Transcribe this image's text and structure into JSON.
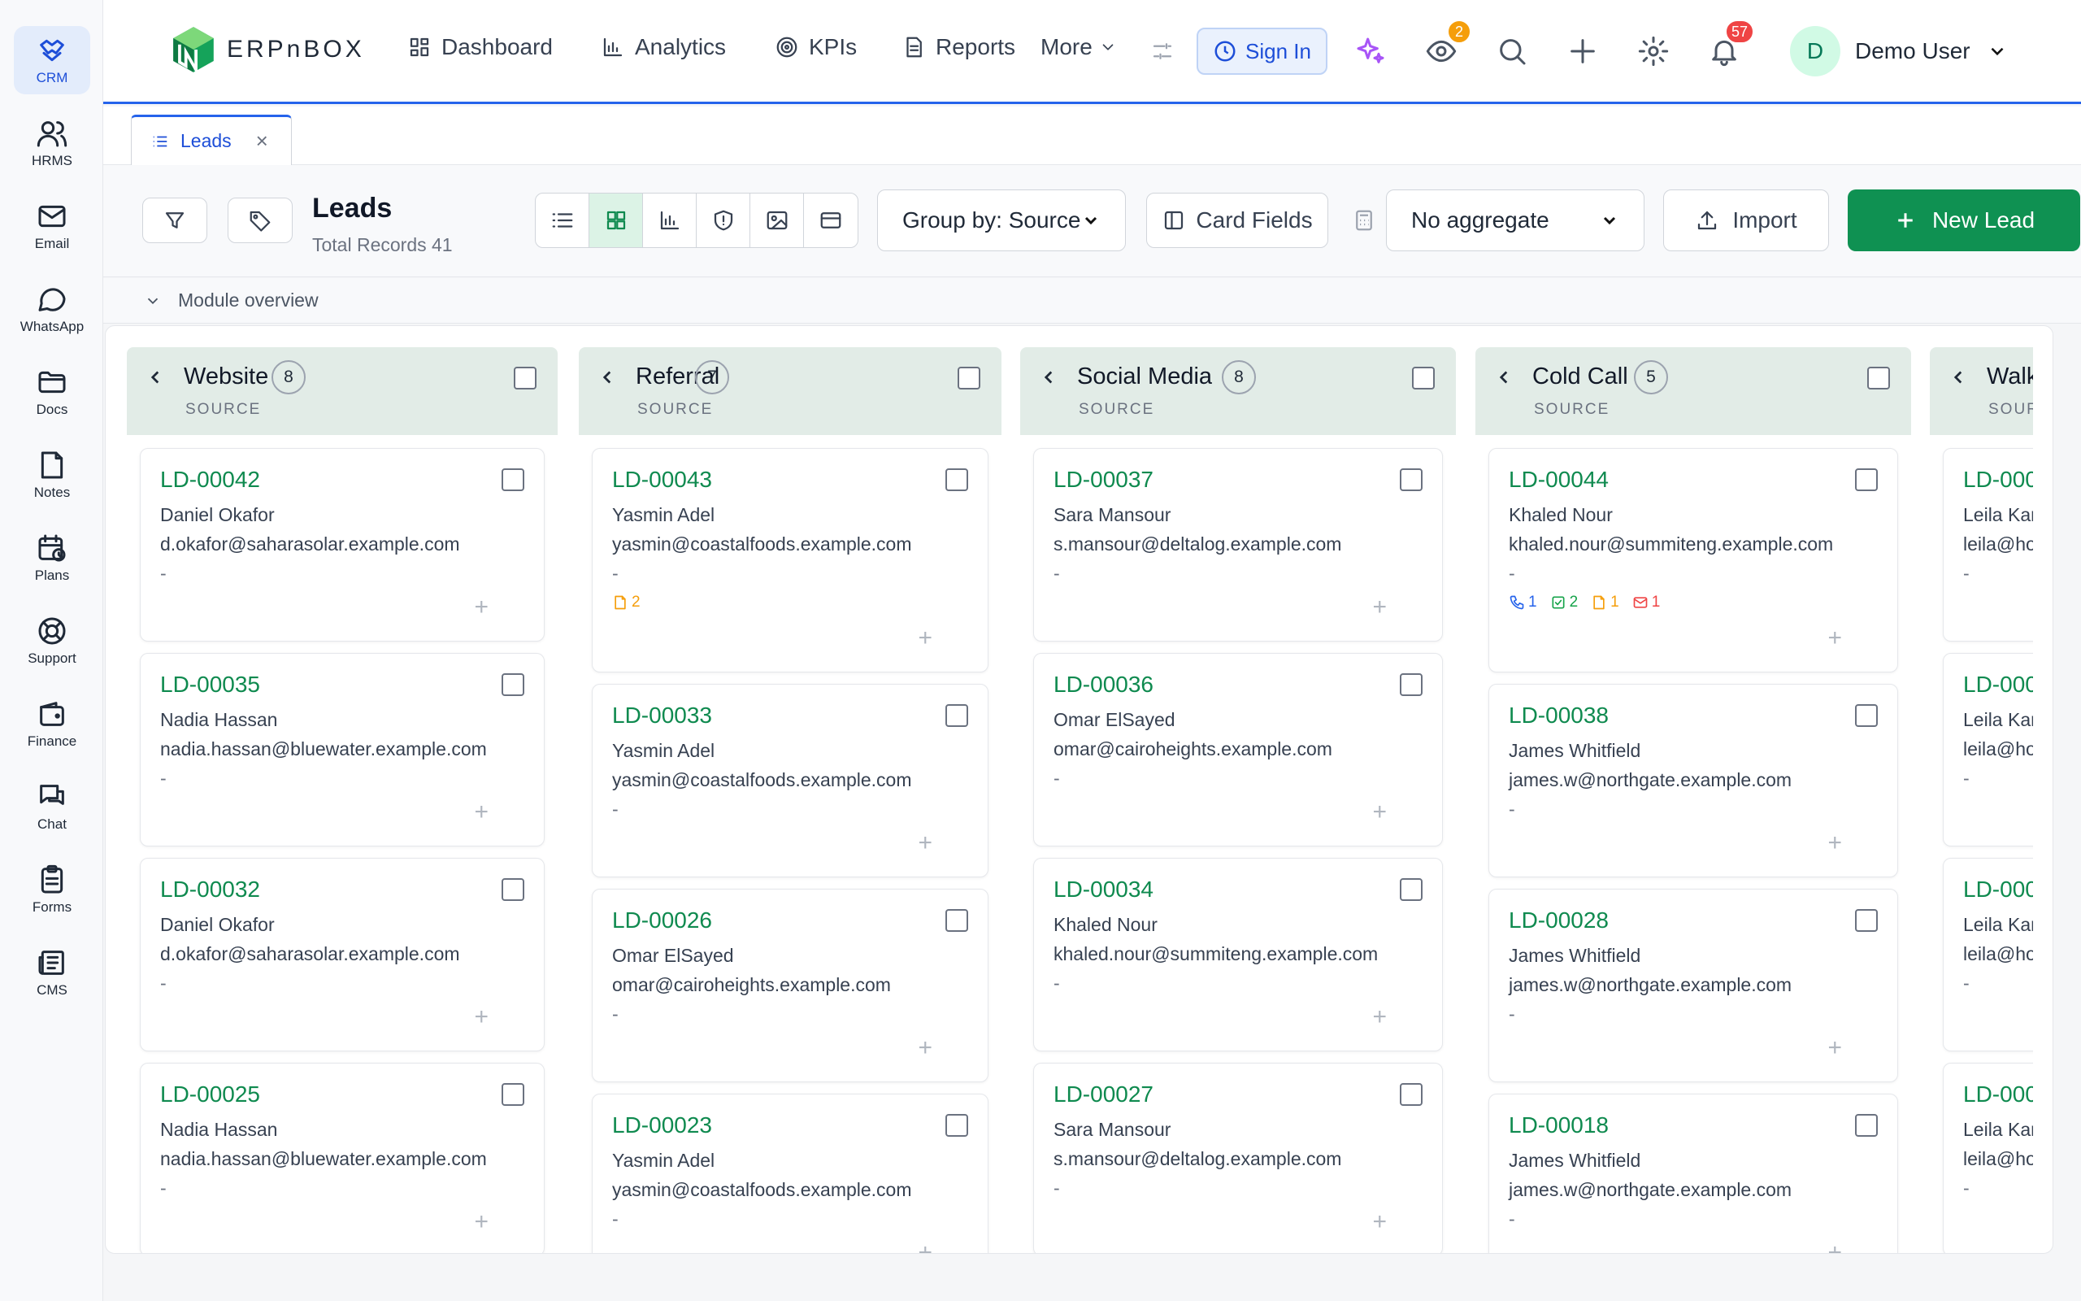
{
  "sidebar": {
    "items": [
      {
        "label": "CRM",
        "icon": "crm-icon"
      },
      {
        "label": "HRMS",
        "icon": "users-icon"
      },
      {
        "label": "Email",
        "icon": "mail-icon"
      },
      {
        "label": "WhatsApp",
        "icon": "chat-bubble-icon"
      },
      {
        "label": "Docs",
        "icon": "folder-icon"
      },
      {
        "label": "Notes",
        "icon": "note-icon"
      },
      {
        "label": "Plans",
        "icon": "calendar-clock-icon"
      },
      {
        "label": "Support",
        "icon": "lifebuoy-icon"
      },
      {
        "label": "Finance",
        "icon": "wallet-icon"
      },
      {
        "label": "Chat",
        "icon": "messages-icon"
      },
      {
        "label": "Forms",
        "icon": "clipboard-icon"
      },
      {
        "label": "CMS",
        "icon": "newspaper-icon"
      }
    ]
  },
  "header": {
    "logo_text": "ERPnBOX",
    "nav": [
      {
        "label": "Dashboard"
      },
      {
        "label": "Analytics"
      },
      {
        "label": "KPIs"
      },
      {
        "label": "Reports"
      },
      {
        "label": "More"
      }
    ],
    "sign_in": "Sign In",
    "watch_badge": "2",
    "notif_badge": "57",
    "user_initial": "D",
    "user_name": "Demo User"
  },
  "tabs": [
    {
      "label": "Leads"
    }
  ],
  "toolbar": {
    "title": "Leads",
    "subtitle": "Total Records 41",
    "group_by": "Group by: Source",
    "card_fields": "Card Fields",
    "aggregate": "No aggregate",
    "import": "Import",
    "new_lead": "New Lead"
  },
  "overview": {
    "label": "Module overview"
  },
  "colors": {
    "accent": "#0f9152",
    "primary": "#2563eb",
    "column_header": "#e2ece7"
  },
  "board": {
    "columns": [
      {
        "name": "Website",
        "count": "8",
        "sub": "SOURCE",
        "cards": [
          {
            "id": "LD-00042",
            "name": "Daniel Okafor",
            "email": "d.okafor@saharasolar.example.com",
            "dash": "-"
          },
          {
            "id": "LD-00035",
            "name": "Nadia Hassan",
            "email": "nadia.hassan@bluewater.example.com",
            "dash": "-"
          },
          {
            "id": "LD-00032",
            "name": "Daniel Okafor",
            "email": "d.okafor@saharasolar.example.com",
            "dash": "-"
          },
          {
            "id": "LD-00025",
            "name": "Nadia Hassan",
            "email": "nadia.hassan@bluewater.example.com",
            "dash": "-"
          }
        ]
      },
      {
        "name": "Referral",
        "count": "7",
        "sub": "SOURCE",
        "cards": [
          {
            "id": "LD-00043",
            "name": "Yasmin Adel",
            "email": "yasmin@coastalfoods.example.com",
            "dash": "-",
            "notes": "2"
          },
          {
            "id": "LD-00033",
            "name": "Yasmin Adel",
            "email": "yasmin@coastalfoods.example.com",
            "dash": "-"
          },
          {
            "id": "LD-00026",
            "name": "Omar ElSayed",
            "email": "omar@cairoheights.example.com",
            "dash": "-"
          },
          {
            "id": "LD-00023",
            "name": "Yasmin Adel",
            "email": "yasmin@coastalfoods.example.com",
            "dash": "-"
          }
        ]
      },
      {
        "name": "Social Media",
        "count": "8",
        "sub": "SOURCE",
        "cards": [
          {
            "id": "LD-00037",
            "name": "Sara Mansour",
            "email": "s.mansour@deltalog.example.com",
            "dash": "-"
          },
          {
            "id": "LD-00036",
            "name": "Omar ElSayed",
            "email": "omar@cairoheights.example.com",
            "dash": "-"
          },
          {
            "id": "LD-00034",
            "name": "Khaled Nour",
            "email": "khaled.nour@summiteng.example.com",
            "dash": "-"
          },
          {
            "id": "LD-00027",
            "name": "Sara Mansour",
            "email": "s.mansour@deltalog.example.com",
            "dash": "-"
          }
        ]
      },
      {
        "name": "Cold Call",
        "count": "5",
        "sub": "SOURCE",
        "cards": [
          {
            "id": "LD-00044",
            "name": "Khaled Nour",
            "email": "khaled.nour@summiteng.example.com",
            "dash": "-",
            "calls": "1",
            "tasks": "2",
            "notes": "1",
            "emails": "1"
          },
          {
            "id": "LD-00038",
            "name": "James Whitfield",
            "email": "james.w@northgate.example.com",
            "dash": "-"
          },
          {
            "id": "LD-00028",
            "name": "James Whitfield",
            "email": "james.w@northgate.example.com",
            "dash": "-"
          },
          {
            "id": "LD-00018",
            "name": "James Whitfield",
            "email": "james.w@northgate.example.com",
            "dash": "-"
          }
        ]
      },
      {
        "name": "Walk",
        "count": "",
        "sub": "SOUR",
        "cards": [
          {
            "id": "LD-000",
            "name": "Leila Kar",
            "email": "leila@ho",
            "dash": "-"
          },
          {
            "id": "LD-000",
            "name": "Leila Kar",
            "email": "leila@ho",
            "dash": "-"
          },
          {
            "id": "LD-000",
            "name": "Leila Kar",
            "email": "leila@ho",
            "dash": "-"
          },
          {
            "id": "LD-000",
            "name": "Leila Kar",
            "email": "leila@ho",
            "dash": "-"
          }
        ]
      }
    ]
  }
}
